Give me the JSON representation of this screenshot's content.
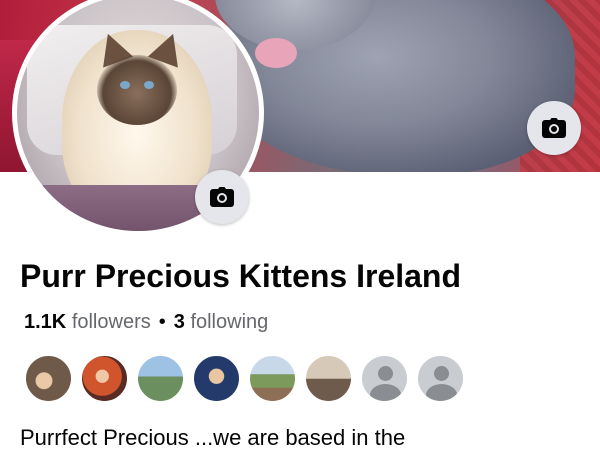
{
  "profile": {
    "name": "Purr Precious Kittens Ireland",
    "followers_count": "1.1K",
    "followers_label": "followers",
    "separator": "•",
    "following_count": "3",
    "following_label": "following",
    "intro": "Purrfect Precious ...we are based in the"
  },
  "buttons": {
    "cover_camera_icon": "camera-icon",
    "avatar_camera_icon": "camera-icon"
  },
  "friends": {
    "avatars": [
      "friend-photo",
      "friend-photo",
      "friend-photo",
      "friend-photo",
      "friend-photo",
      "friend-photo",
      "default-avatar",
      "default-avatar"
    ]
  },
  "colors": {
    "name_text": "#050505",
    "secondary_text": "#65676b",
    "icon_button_bg": "#e4e6eb"
  }
}
